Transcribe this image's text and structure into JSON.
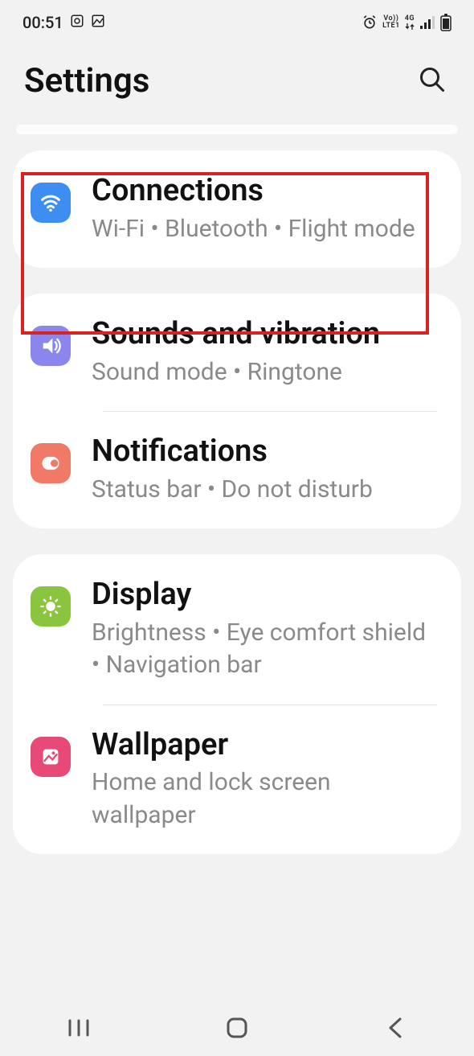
{
  "status": {
    "time": "00:51",
    "net1": "Vo))",
    "net2": "LTE1",
    "net3": "4G"
  },
  "header": {
    "title": "Settings"
  },
  "groups": [
    {
      "items": [
        {
          "title": "Connections",
          "sub": "Wi-Fi  •  Bluetooth  •  Flight mode"
        }
      ]
    },
    {
      "items": [
        {
          "title": "Sounds and vibration",
          "sub": "Sound mode  •  Ringtone"
        },
        {
          "title": "Notifications",
          "sub": "Status bar  •  Do not disturb"
        }
      ]
    },
    {
      "items": [
        {
          "title": "Display",
          "sub": "Brightness  •  Eye comfort shield  •  Navigation bar"
        },
        {
          "title": "Wallpaper",
          "sub": "Home and lock screen wallpaper"
        }
      ]
    }
  ]
}
